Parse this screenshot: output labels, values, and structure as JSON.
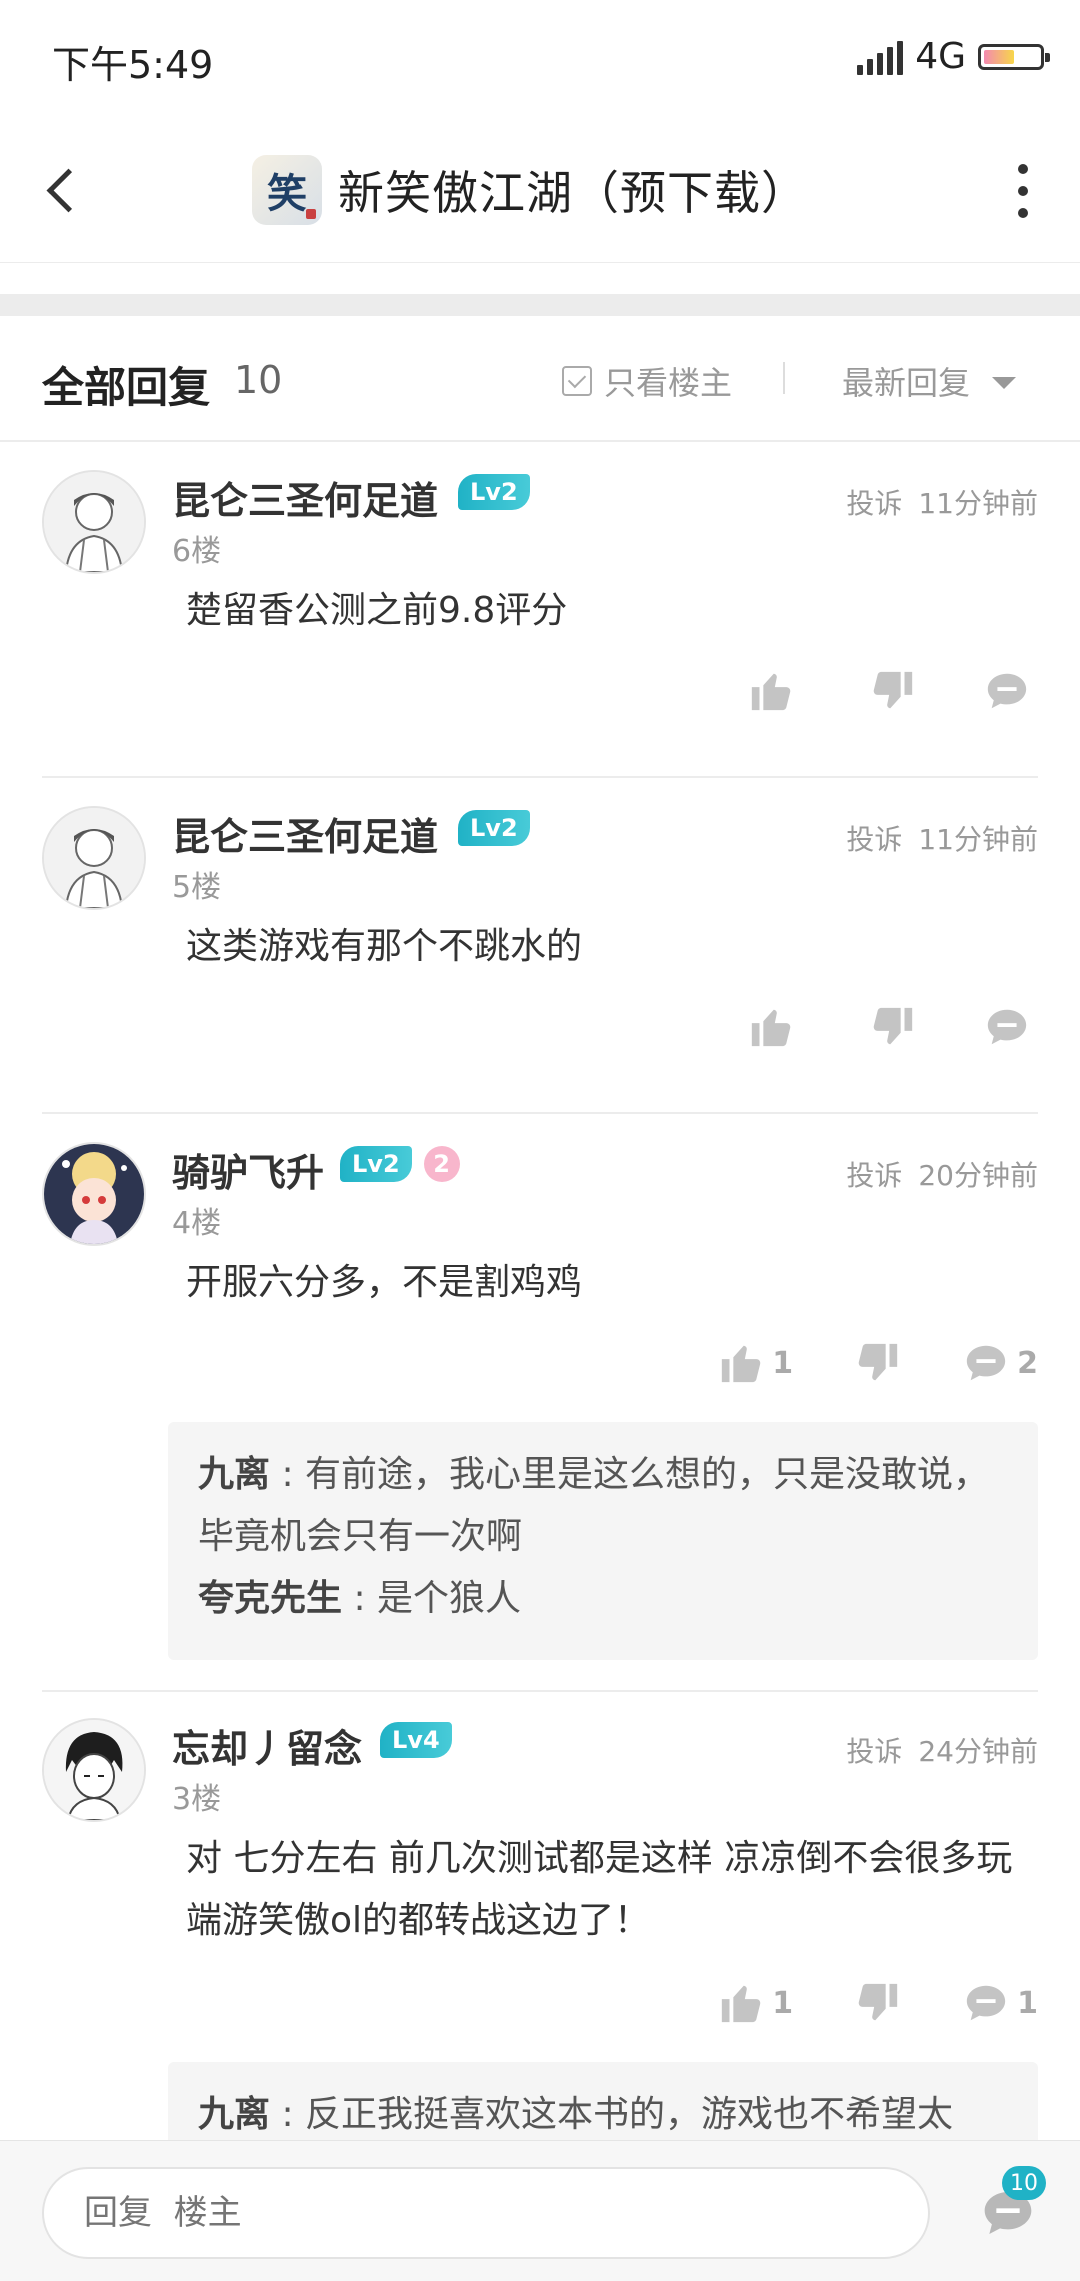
{
  "status_bar": {
    "time": "下午5:49",
    "network": "4G"
  },
  "nav": {
    "logo_text": "笑",
    "title": "新笑傲江湖（预下载）"
  },
  "replies_header": {
    "title": "全部回复",
    "count": "10",
    "owner_only_label": "只看楼主",
    "sort_label": "最新回复"
  },
  "posts": [
    {
      "username": "昆仑三圣何足道",
      "level": "Lv2",
      "report": "投诉",
      "time": "11分钟前",
      "floor": "6楼",
      "content": "楚留香公测之前9.8评分",
      "likes": "",
      "comments": ""
    },
    {
      "username": "昆仑三圣何足道",
      "level": "Lv2",
      "report": "投诉",
      "time": "11分钟前",
      "floor": "5楼",
      "content": "这类游戏有那个不跳水的",
      "likes": "",
      "comments": ""
    },
    {
      "username": "骑驴飞升",
      "level": "Lv2",
      "extra_badge": "2",
      "report": "投诉",
      "time": "20分钟前",
      "floor": "4楼",
      "content": "开服六分多，不是割鸡鸡",
      "likes": "1",
      "comments": "2",
      "sub_replies": [
        {
          "name": "九离",
          "text": "有前途，我心里是这么想的，只是没敢说，毕竟机会只有一次啊"
        },
        {
          "name": "夸克先生",
          "text": "是个狼人"
        }
      ]
    },
    {
      "username": "忘却丿留念",
      "level": "Lv4",
      "report": "投诉",
      "time": "24分钟前",
      "floor": "3楼",
      "content": "对 七分左右  前几次测试都是这样  凉凉倒不会很多玩端游笑傲ol的都转战这边了！",
      "likes": "1",
      "comments": "1",
      "sub_replies": [
        {
          "name": "九离",
          "text": "反正我挺喜欢这本书的，游戏也不希望太"
        }
      ]
    }
  ],
  "reply_bar": {
    "placeholder": "回复  楼主",
    "badge_count": "10"
  },
  "colors": {
    "accent": "#20b2c6",
    "badge_pink": "#f8b6cc",
    "text": "#333333",
    "muted": "#999999"
  }
}
